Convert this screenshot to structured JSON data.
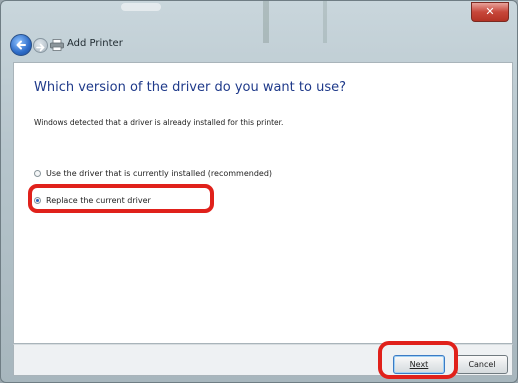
{
  "window": {
    "title": "Add Printer",
    "close_glyph": "✕"
  },
  "content": {
    "heading": "Which version of the driver do you want to use?",
    "description": "Windows detected that a driver is already installed for this printer."
  },
  "options": [
    {
      "label": "Use the driver that is currently installed (recommended)",
      "selected": false
    },
    {
      "label": "Replace the current driver",
      "selected": true
    }
  ],
  "buttons": {
    "next": "Next",
    "cancel": "Cancel"
  },
  "colors": {
    "heading": "#1f3a8a",
    "highlight": "#e0211b"
  },
  "icons": {
    "back": "back-arrow-icon",
    "forward": "forward-arrow-icon",
    "printer": "printer-icon",
    "close": "close-icon"
  }
}
